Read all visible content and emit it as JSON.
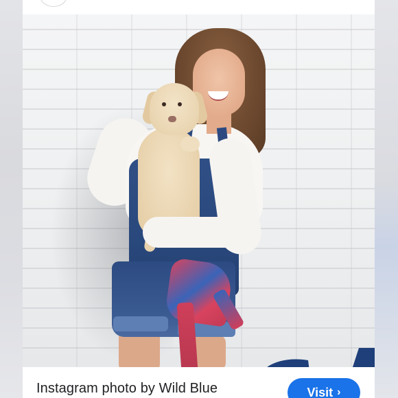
{
  "result": {
    "title": "Instagram photo by Wild Blue",
    "visit_label": "Visit",
    "visit_icon": "chevron-right-icon"
  },
  "colors": {
    "accent": "#1a73e8",
    "card_bg": "#ffffff",
    "page_bg": "#e9eaee"
  }
}
